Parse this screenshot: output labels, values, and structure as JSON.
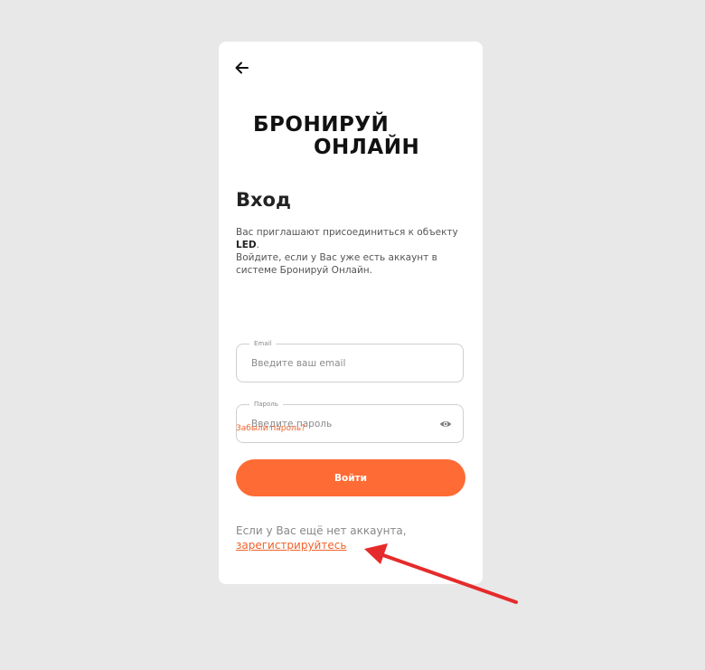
{
  "colors": {
    "page_background": "#e8e8e8",
    "card_background": "#ffffff",
    "accent": "#ff6b35",
    "link": "#f0622b",
    "annotation_arrow": "#e52b2b"
  },
  "icons": {
    "back": "arrow-left",
    "password_toggle": "eye",
    "annotation": "red-arrow"
  },
  "brand": {
    "line1": "БРОНИРУЙ",
    "line2": "ОНЛАЙН"
  },
  "login": {
    "title": "Вход",
    "description": {
      "invite_prefix": "Вас приглашают присоединиться к объекту ",
      "object_name": "LED",
      "invite_suffix": ".",
      "login_hint": "Войдите, если у Вас уже есть аккаунт в системе Бронируй Онлайн."
    },
    "email": {
      "label": "Email",
      "placeholder": "Введите ваш email",
      "value": ""
    },
    "password": {
      "label": "Пароль",
      "placeholder": "Введите пароль",
      "value": ""
    },
    "forgot_password": "Забыли пароль?",
    "submit_label": "Войти",
    "no_account_text": "Если у Вас ещё нет аккаунта,",
    "register_link": "зарегистрируйтесь"
  }
}
